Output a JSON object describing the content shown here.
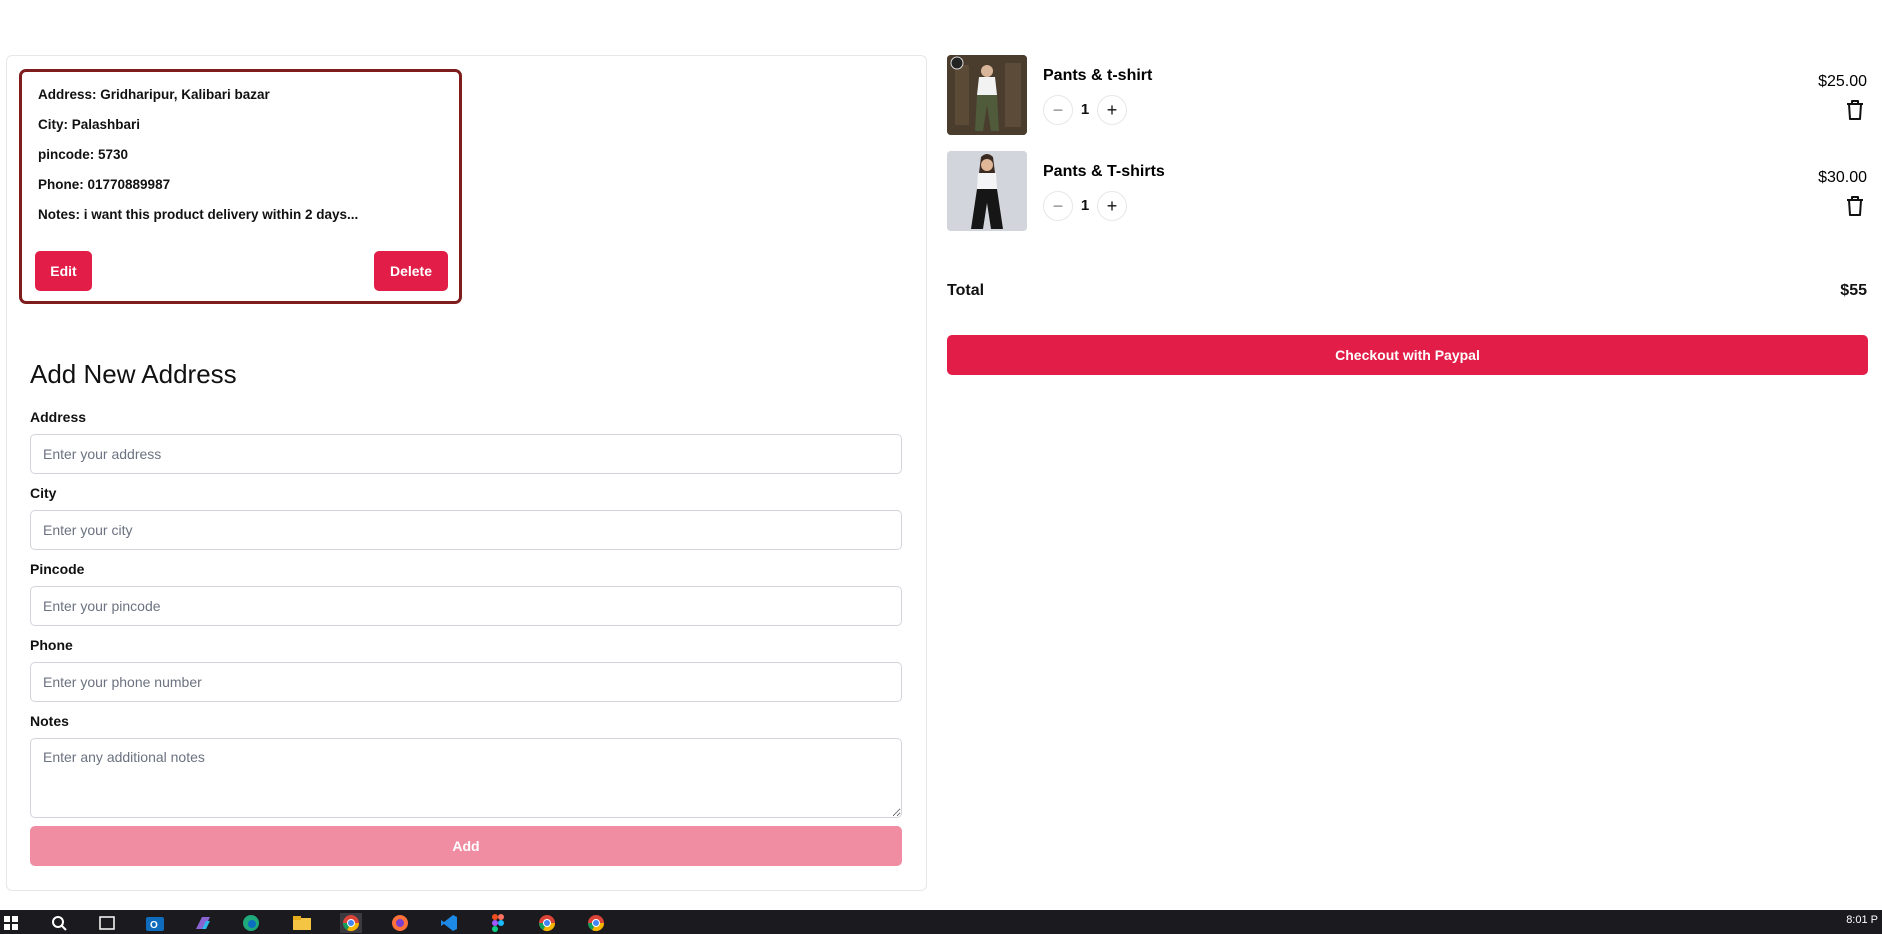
{
  "saved_address": {
    "lines": [
      "Address: Gridharipur, Kalibari bazar",
      "City: Palashbari",
      "pincode: 5730",
      "Phone: 01770889987",
      "Notes: i want this product delivery within 2 days..."
    ],
    "edit_label": "Edit",
    "delete_label": "Delete"
  },
  "form": {
    "title": "Add New Address",
    "address_label": "Address",
    "address_placeholder": "Enter your address",
    "city_label": "City",
    "city_placeholder": "Enter your city",
    "pincode_label": "Pincode",
    "pincode_placeholder": "Enter your pincode",
    "phone_label": "Phone",
    "phone_placeholder": "Enter your phone number",
    "notes_label": "Notes",
    "notes_placeholder": "Enter any additional notes",
    "add_label": "Add"
  },
  "cart": {
    "items": [
      {
        "name": "Pants & t-shirt",
        "quantity": "1",
        "price": "$25.00"
      },
      {
        "name": "Pants & T-shirts",
        "quantity": "1",
        "price": "$30.00"
      }
    ],
    "minus_symbol": "−",
    "plus_symbol": "+",
    "total_label": "Total",
    "total_value": "$55",
    "checkout_label": "Checkout with Paypal"
  },
  "colors": {
    "accent": "#e11d48",
    "accent_disabled": "#f08da2",
    "card_border": "#7f1d1d"
  },
  "taskbar": {
    "icons": [
      "windows-icon",
      "search-icon",
      "task-view-icon",
      "outlook-icon",
      "copilot-icon",
      "edge-icon",
      "file-explorer-icon",
      "chrome-icon",
      "firefox-icon",
      "vscode-icon",
      "figma-icon",
      "chrome-icon",
      "chrome-icon"
    ],
    "clock": "8:01 P"
  }
}
